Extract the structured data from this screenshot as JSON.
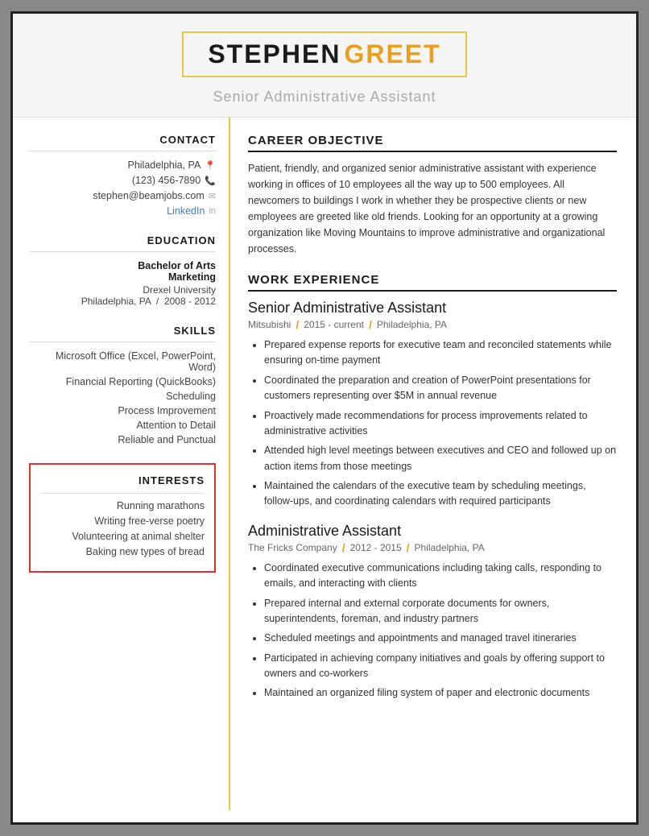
{
  "header": {
    "first_name": "STEPHEN",
    "last_name": "GREET",
    "title": "Senior Administrative Assistant"
  },
  "sidebar": {
    "contact_title": "CONTACT",
    "location": "Philadelphia, PA",
    "phone": "(123) 456-7890",
    "email": "stephen@beamjobs.com",
    "linkedin_label": "LinkedIn",
    "education_title": "EDUCATION",
    "edu_degree": "Bachelor of Arts",
    "edu_field": "Marketing",
    "edu_school": "Drexel University",
    "edu_location": "Philadelphia, PA",
    "edu_year": "2008 - 2012",
    "skills_title": "SKILLS",
    "skills": [
      "Microsoft Office (Excel, PowerPoint, Word)",
      "Financial Reporting (QuickBooks)",
      "Scheduling",
      "Process Improvement",
      "Attention to Detail",
      "Reliable and Punctual"
    ],
    "interests_title": "INTERESTS",
    "interests": [
      "Running marathons",
      "Writing free-verse poetry",
      "Volunteering at animal shelter",
      "Baking new types of bread"
    ]
  },
  "content": {
    "career_title": "CAREER OBJECTIVE",
    "career_text": "Patient, friendly, and organized senior administrative assistant with experience working in offices of 10 employees all the way up to 500 employees. All newcomers to buildings I work in whether they be prospective clients or new employees are greeted like old friends. Looking for an opportunity at a growing organization like Moving Mountains to improve administrative and organizational processes.",
    "work_title": "WORK EXPERIENCE",
    "jobs": [
      {
        "title": "Senior Administrative Assistant",
        "company": "Mitsubishi",
        "period": "2015 - current",
        "location": "Philadelphia, PA",
        "bullets": [
          "Prepared expense reports for executive team and reconciled statements while ensuring on-time payment",
          "Coordinated the preparation and creation of PowerPoint presentations for customers representing over $5M in annual revenue",
          "Proactively made recommendations for process improvements related to administrative activities",
          "Attended high level meetings between executives and CEO and followed up on action items from those meetings",
          "Maintained the calendars of the executive team by scheduling meetings, follow-ups, and coordinating calendars with required participants"
        ]
      },
      {
        "title": "Administrative Assistant",
        "company": "The Fricks Company",
        "period": "2012 - 2015",
        "location": "Philadelphia, PA",
        "bullets": [
          "Coordinated executive communications including taking calls, responding to emails, and interacting with clients",
          "Prepared internal and external corporate documents for owners, superintendents, foreman, and industry partners",
          "Scheduled meetings and appointments and managed travel itineraries",
          "Participated in achieving company initiatives and goals by offering support to owners and co-workers",
          "Maintained an organized filing system of paper and electronic documents"
        ]
      }
    ]
  }
}
